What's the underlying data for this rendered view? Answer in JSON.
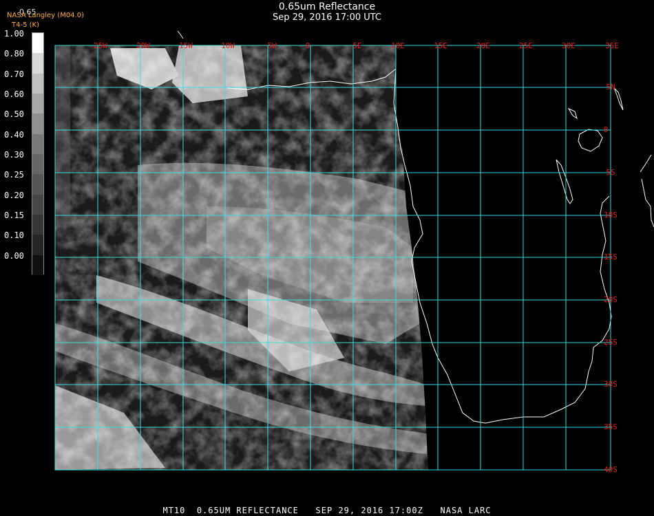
{
  "header": {
    "title": "0.65um Reflectance",
    "subtitle": "Sep 29, 2016 17:00 UTC",
    "brand": "NASA Langley (M04.0)",
    "brand_sub": "T4-5 (K)",
    "top_value": "0.65"
  },
  "colorbar": {
    "labels": [
      "1.00",
      "0.80",
      "0.70",
      "0.60",
      "0.50",
      "0.40",
      "0.30",
      "0.25",
      "0.20",
      "0.15",
      "0.10",
      "0.00"
    ],
    "colors": [
      "#ffffff",
      "#d8d8d8",
      "#c0c0c0",
      "#a8a8a8",
      "#909090",
      "#7a7a7a",
      "#666666",
      "#565656",
      "#464646",
      "#363636",
      "#262626",
      "#111111"
    ]
  },
  "map": {
    "longitude_labels": [
      "25W",
      "20W",
      "15W",
      "10W",
      "5W",
      "0",
      "5E",
      "10E",
      "15E",
      "20E",
      "25E",
      "30E",
      "35E"
    ],
    "latitude_labels": [
      "5N",
      "0",
      "5S",
      "10S",
      "15S",
      "20S",
      "25S",
      "30S",
      "35S",
      "40S"
    ],
    "grid_color": "#35e0e0",
    "label_color": "#e02020",
    "coast_color": "#ffffff"
  },
  "footer": {
    "text": "MT10  0.65UM REFLECTANCE   SEP 29, 2016 17:00Z   NASA LARC"
  }
}
